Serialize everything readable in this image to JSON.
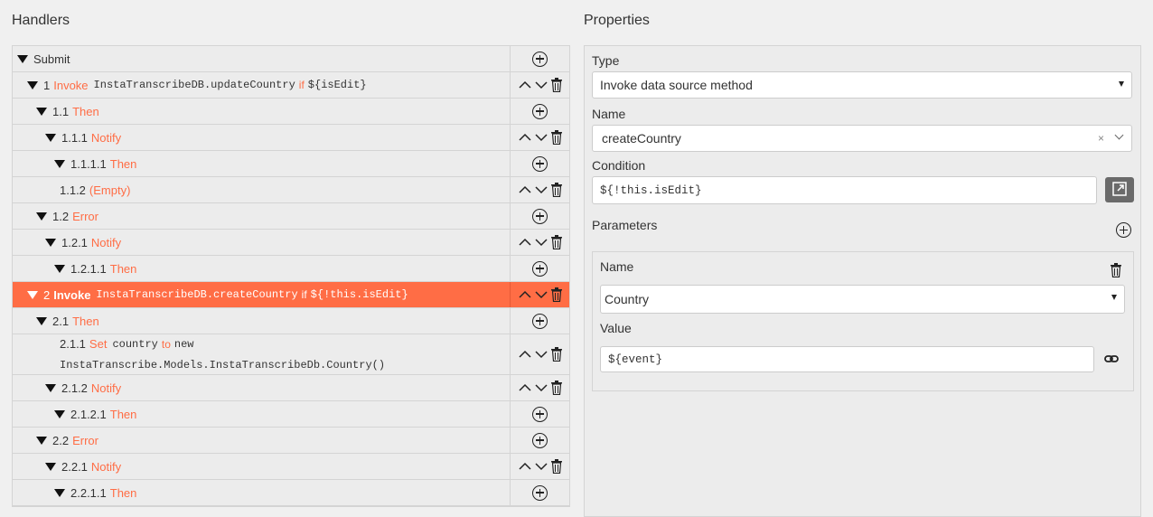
{
  "handlers": {
    "title": "Handlers",
    "rows": [
      {
        "id": "r-submit",
        "num": "",
        "kw": "Submit",
        "plain": true
      },
      {
        "id": "r1",
        "num": "1",
        "kw": "Invoke",
        "code": "InstaTranscribeDB.updateCountry",
        "cond_kw": "if",
        "cond": "${isEdit}"
      },
      {
        "id": "r11",
        "num": "1.1",
        "kw": "Then"
      },
      {
        "id": "r111",
        "num": "1.1.1",
        "kw": "Notify"
      },
      {
        "id": "r1111",
        "num": "1.1.1.1",
        "kw": "Then"
      },
      {
        "id": "r112",
        "num": "1.1.2",
        "kw": "(Empty)"
      },
      {
        "id": "r12",
        "num": "1.2",
        "kw": "Error"
      },
      {
        "id": "r121",
        "num": "1.2.1",
        "kw": "Notify"
      },
      {
        "id": "r1211",
        "num": "1.2.1.1",
        "kw": "Then"
      },
      {
        "id": "r2",
        "num": "2",
        "kw": "Invoke",
        "code": "InstaTranscribeDB.createCountry",
        "cond_kw": "if",
        "cond": "${!this.isEdit}"
      },
      {
        "id": "r21",
        "num": "2.1",
        "kw": "Then"
      },
      {
        "id": "r211",
        "num": "2.1.1",
        "kw": "Set",
        "code": "country",
        "to_kw": "to",
        "value": "new",
        "value2": "InstaTranscribe.Models.InstaTranscribeDb.Country()"
      },
      {
        "id": "r212",
        "num": "2.1.2",
        "kw": "Notify"
      },
      {
        "id": "r2121",
        "num": "2.1.2.1",
        "kw": "Then"
      },
      {
        "id": "r22",
        "num": "2.2",
        "kw": "Error"
      },
      {
        "id": "r221",
        "num": "2.2.1",
        "kw": "Notify"
      },
      {
        "id": "r2211",
        "num": "2.2.1.1",
        "kw": "Then"
      }
    ]
  },
  "properties": {
    "title": "Properties",
    "type_label": "Type",
    "type_value": "Invoke data source method",
    "name_label": "Name",
    "name_value": "createCountry",
    "clear_glyph": "×",
    "condition_label": "Condition",
    "condition_value": "${!this.isEdit}",
    "parameters_label": "Parameters",
    "param": {
      "name_label": "Name",
      "name_value": "Country",
      "value_label": "Value",
      "value_value": "${event}"
    }
  },
  "colors": {
    "accent": "#ff6d45",
    "selected_row": "#ff6d45",
    "panel_bg": "#ececec",
    "external_button": "#6a6a6a"
  },
  "icons": {
    "expand": "triangle-down-icon",
    "add": "plus-circle-icon",
    "up": "chevron-up-icon",
    "down": "chevron-down-icon",
    "delete": "trash-icon",
    "external": "external-link-icon",
    "link": "link-icon"
  }
}
